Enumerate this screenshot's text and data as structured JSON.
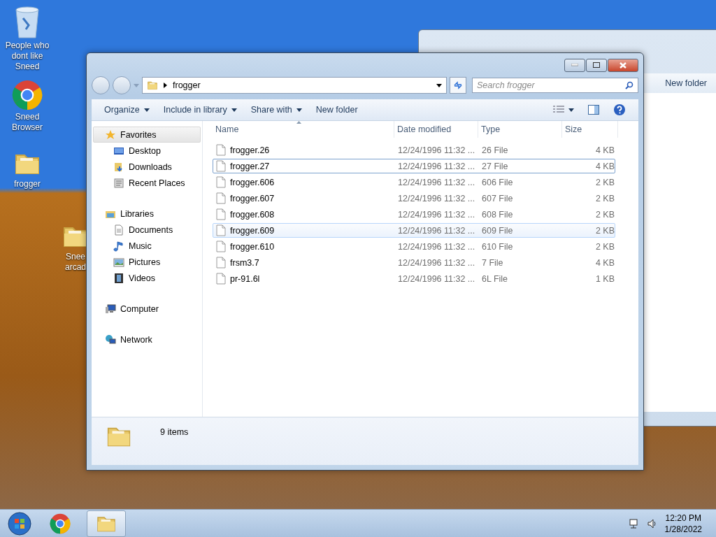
{
  "desktop_icons": [
    {
      "kind": "recycle",
      "label": "People who dont like Sneed"
    },
    {
      "kind": "chrome",
      "label": "Sneed Browser"
    },
    {
      "kind": "folder",
      "label": "frogger"
    },
    {
      "kind": "folder",
      "label": "Snee arcad"
    }
  ],
  "back_window": {
    "toolbar": [
      "New folder"
    ]
  },
  "window": {
    "address": "frogger",
    "search": {
      "placeholder": "Search frogger"
    },
    "toolbar": [
      "Organize",
      "Include in library",
      "Share with",
      "New folder"
    ],
    "toolbar_menus": [
      true,
      true,
      true,
      false
    ],
    "nav": [
      {
        "label": "Favorites",
        "kind": "favorites",
        "selected": true,
        "children": [
          {
            "label": "Desktop",
            "kind": "desktop",
            "selected": false
          },
          {
            "label": "Downloads",
            "kind": "downloads",
            "selected": false
          },
          {
            "label": "Recent Places",
            "kind": "recent",
            "selected": false
          }
        ]
      },
      {
        "label": "Libraries",
        "kind": "libraries",
        "selected": false,
        "children": [
          {
            "label": "Documents",
            "kind": "documents",
            "selected": false
          },
          {
            "label": "Music",
            "kind": "music",
            "selected": false
          },
          {
            "label": "Pictures",
            "kind": "pictures",
            "selected": false
          },
          {
            "label": "Videos",
            "kind": "videos",
            "selected": false
          }
        ]
      },
      {
        "label": "Computer",
        "kind": "computer",
        "selected": false
      },
      {
        "label": "Network",
        "kind": "network",
        "selected": false
      }
    ],
    "columns": [
      "Name",
      "Date modified",
      "Type",
      "Size"
    ],
    "rows": [
      {
        "name": "frogger.26",
        "date": "12/24/1996 11:32 ...",
        "type": "26 File",
        "size": "4 KB",
        "focused": false,
        "hovered": false
      },
      {
        "name": "frogger.27",
        "date": "12/24/1996 11:32 ...",
        "type": "27 File",
        "size": "4 KB",
        "focused": true,
        "hovered": false
      },
      {
        "name": "frogger.606",
        "date": "12/24/1996 11:32 ...",
        "type": "606 File",
        "size": "2 KB",
        "focused": false,
        "hovered": false
      },
      {
        "name": "frogger.607",
        "date": "12/24/1996 11:32 ...",
        "type": "607 File",
        "size": "2 KB",
        "focused": false,
        "hovered": false
      },
      {
        "name": "frogger.608",
        "date": "12/24/1996 11:32 ...",
        "type": "608 File",
        "size": "2 KB",
        "focused": false,
        "hovered": false
      },
      {
        "name": "frogger.609",
        "date": "12/24/1996 11:32 ...",
        "type": "609 File",
        "size": "2 KB",
        "focused": false,
        "hovered": true
      },
      {
        "name": "frogger.610",
        "date": "12/24/1996 11:32 ...",
        "type": "610 File",
        "size": "2 KB",
        "focused": false,
        "hovered": false
      },
      {
        "name": "frsm3.7",
        "date": "12/24/1996 11:32 ...",
        "type": "7 File",
        "size": "4 KB",
        "focused": false,
        "hovered": false
      },
      {
        "name": "pr-91.6l",
        "date": "12/24/1996 11:32 ...",
        "type": "6L File",
        "size": "1 KB",
        "focused": false,
        "hovered": false
      }
    ],
    "status": "9 items"
  },
  "taskbar": {
    "apps": [
      {
        "kind": "chrome",
        "active": false
      },
      {
        "kind": "explorer",
        "active": true
      }
    ],
    "time": "12:20 PM",
    "date": "1/28/2022"
  }
}
